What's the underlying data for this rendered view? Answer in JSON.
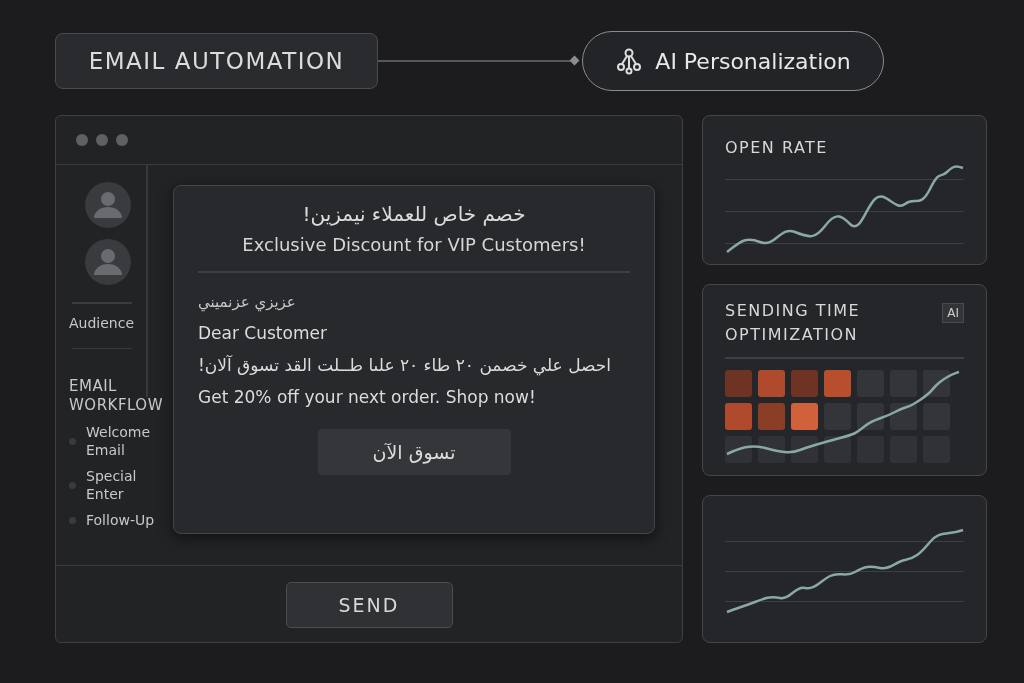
{
  "header": {
    "title": "EMAIL AUTOMATION",
    "ai_pill": "AI Personalization"
  },
  "sidebar": {
    "audience": "Audience",
    "workflow_title": "EMAIL WORKFLOW",
    "workflow_items": [
      "Welcome Email",
      "Special Enter",
      "Follow-Up"
    ]
  },
  "message": {
    "title_ar": "خصم خاص للعملاء نيمزين!",
    "title_en": "Exclusive Discount for VIP Customers!",
    "greeting_ar": "عزيزي عزنميني",
    "greeting_en": "Dear Customer",
    "body_ar": "احصل علي خصمن ٢٠ طاء ٢٠ علىا طــلت القد تسوق آلان!",
    "body_en": "Get 20% off your next order. Shop now!",
    "button": "تسوق الآن"
  },
  "send_button": "SEND",
  "open_rate": {
    "title": "OPEN RATE"
  },
  "sending_time": {
    "title": "SENDING TIME OPTIMIZATION",
    "badge": "AI",
    "cells": [
      {
        "color": "#6e3322"
      },
      {
        "color": "#b04a2c"
      },
      {
        "color": "#6e3322"
      },
      {
        "color": "#b84e2c"
      },
      {
        "color": "#343538"
      },
      {
        "color": "#343538"
      },
      {
        "color": "#343538"
      },
      {
        "color": "#b04a2c"
      },
      {
        "color": "#8a3e26"
      },
      {
        "color": "#d0613a"
      },
      {
        "color": "#343538"
      },
      {
        "color": "#343538"
      },
      {
        "color": "#343538"
      },
      {
        "color": "#343538"
      },
      {
        "color": "#313235"
      },
      {
        "color": "#313235"
      },
      {
        "color": "#313235"
      },
      {
        "color": "#313235"
      },
      {
        "color": "#313235"
      },
      {
        "color": "#313235"
      },
      {
        "color": "#313235"
      }
    ]
  }
}
